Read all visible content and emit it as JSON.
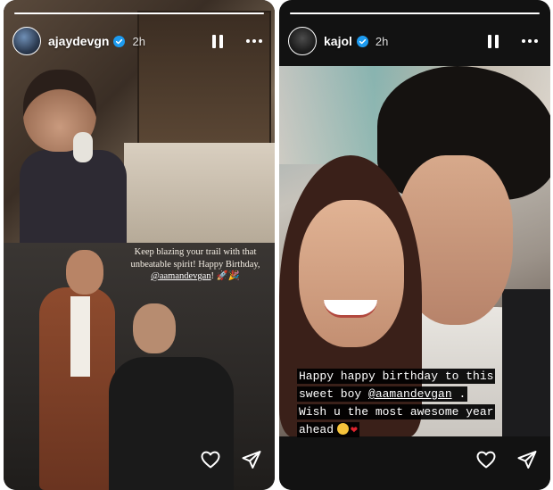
{
  "stories": {
    "left": {
      "username": "ajaydevgn",
      "time": "2h",
      "caption_line1": "Keep blazing your trail with that",
      "caption_line2": "unbeatable spirit! Happy Birthday,",
      "caption_mention": "@aamandevgan",
      "caption_end": "! 🚀🎉"
    },
    "right": {
      "username": "kajol",
      "time": "2h",
      "caption_line1a": "Happy happy birthday to this",
      "caption_line2a": "sweet boy ",
      "caption_mention": "@aamandevgan",
      "caption_line2b": " .",
      "caption_line3": "Wish u the most awesome year",
      "caption_line4": "ahead"
    }
  },
  "icons": {
    "verified": "verified-badge-icon",
    "pause": "pause-icon",
    "more": "more-options-icon",
    "like": "heart-icon",
    "share": "send-icon"
  },
  "colors": {
    "verified_badge": "#1d9bf0",
    "heart_emoji": "#e0242e",
    "background": "#121212"
  }
}
